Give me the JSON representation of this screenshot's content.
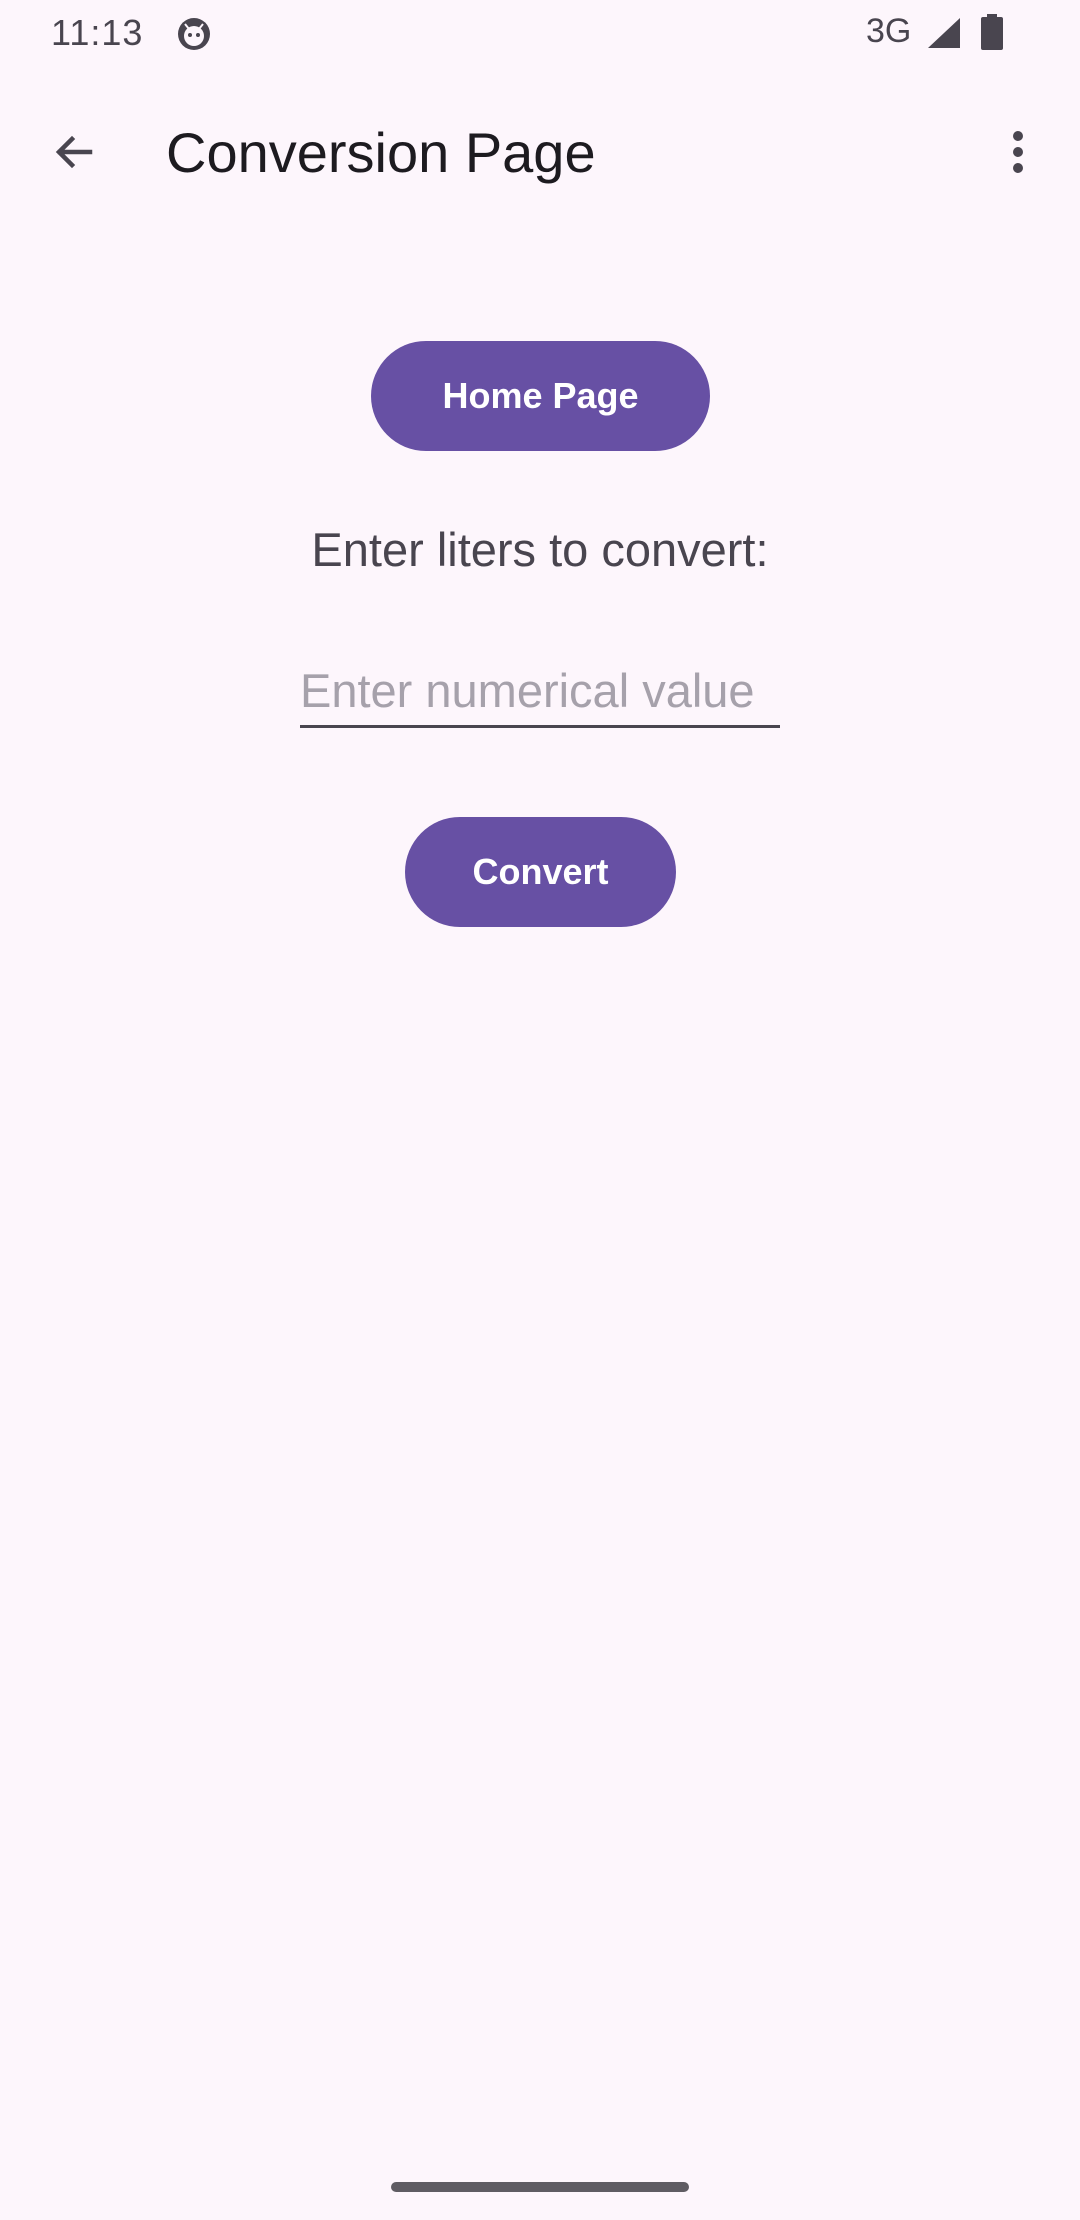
{
  "status_bar": {
    "time": "11:13",
    "network": "3G",
    "notification_icon": "android-face-icon",
    "signal_icon": "cell-signal-icon",
    "battery_icon": "battery-icon"
  },
  "app_bar": {
    "back_icon": "arrow-back-icon",
    "title": "Conversion Page",
    "overflow_icon": "more-vert-icon"
  },
  "main": {
    "home_button_label": "Home Page",
    "prompt": "Enter liters to convert:",
    "input": {
      "value": "",
      "placeholder": "Enter numerical value"
    },
    "convert_button_label": "Convert"
  },
  "colors": {
    "background": "#fdf6fc",
    "primary": "#6750a4",
    "on_primary": "#ffffff",
    "text": "#1d1b20",
    "secondary_text": "#49454f",
    "placeholder": "#a6a1ab"
  }
}
